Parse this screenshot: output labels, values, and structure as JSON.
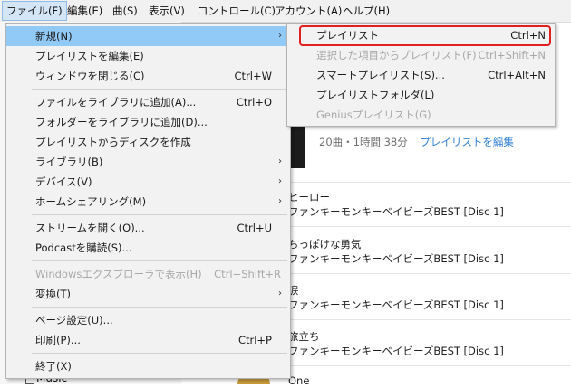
{
  "menubar": {
    "items": [
      {
        "label": "ファイル(F)"
      },
      {
        "label": "編集(E)"
      },
      {
        "label": "曲(S)"
      },
      {
        "label": "表示(V)"
      },
      {
        "label": "コントロール(C)"
      },
      {
        "label": "アカウント(A)"
      },
      {
        "label": "ヘルプ(H)"
      }
    ]
  },
  "file_menu": {
    "items": [
      {
        "label": "新規(N)",
        "submenu": true
      },
      {
        "label": "プレイリストを編集(E)"
      },
      {
        "label": "ウィンドウを閉じる(C)",
        "shortcut": "Ctrl+W"
      },
      {
        "label": "ファイルをライブラリに追加(A)...",
        "shortcut": "Ctrl+O"
      },
      {
        "label": "フォルダーをライブラリに追加(D)..."
      },
      {
        "label": "プレイリストからディスクを作成"
      },
      {
        "label": "ライブラリ(B)",
        "submenu": true
      },
      {
        "label": "デバイス(V)",
        "submenu": true
      },
      {
        "label": "ホームシェアリング(M)",
        "submenu": true
      },
      {
        "label": "ストリームを開く(O)...",
        "shortcut": "Ctrl+U"
      },
      {
        "label": "Podcastを購読(S)..."
      },
      {
        "label": "Windowsエクスプローラで表示(H)",
        "shortcut": "Ctrl+Shift+R",
        "disabled": true
      },
      {
        "label": "変換(T)",
        "submenu": true
      },
      {
        "label": "ページ設定(U)..."
      },
      {
        "label": "印刷(P)...",
        "shortcut": "Ctrl+P"
      },
      {
        "label": "終了(X)"
      }
    ]
  },
  "new_submenu": {
    "items": [
      {
        "label": "プレイリスト",
        "shortcut": "Ctrl+N"
      },
      {
        "label": "選択した項目からプレイリスト(F)",
        "shortcut": "Ctrl+Shift+N",
        "disabled": true
      },
      {
        "label": "スマートプレイリスト(S)...",
        "shortcut": "Ctrl+Alt+N"
      },
      {
        "label": "プレイリストフォルダ(L)"
      },
      {
        "label": "Geniusプレイリスト(G)",
        "disabled": true
      }
    ]
  },
  "background": {
    "playlist_meta": "20曲・1時間 38分",
    "edit_link": "プレイリストを編集",
    "songs": [
      {
        "title": "ヒーロー",
        "album": "ファンキーモンキーベイビーズBEST [Disc 1]"
      },
      {
        "title": "ちっぽけな勇気",
        "album": "ファンキーモンキーベイビーズBEST [Disc 1]"
      },
      {
        "title": "涙",
        "album": "ファンキーモンキーベイビーズBEST [Disc 1]"
      },
      {
        "title": "旅立ち",
        "album": "ファンキーモンキーベイビーズBEST [Disc 1]"
      },
      {
        "title": "One",
        "album": ""
      }
    ],
    "sidebar_music": "Music"
  },
  "colors": {
    "menu_highlight": "#91c9f7",
    "annotation_red": "#e0201e",
    "link_blue": "#2f7fd1"
  }
}
